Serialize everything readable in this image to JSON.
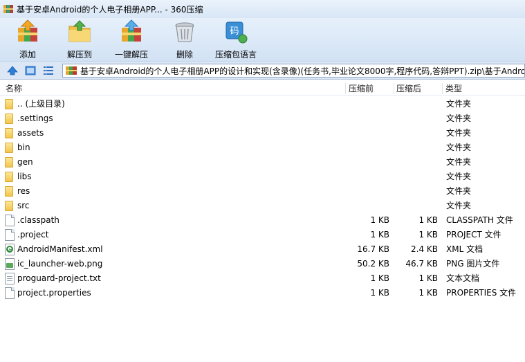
{
  "window": {
    "title": "基于安卓Android的个人电子相册APP... - 360压缩"
  },
  "toolbar": {
    "add_label": "添加",
    "extract_to_label": "解压到",
    "one_click_extract_label": "一键解压",
    "delete_label": "删除",
    "language_pack_label": "压缩包语言"
  },
  "address": {
    "path": "基于安卓Android的个人电子相册APP的设计和实现(含录像)(任务书,毕业论文8000字,程序代码,答辩PPT).zip\\基于Android"
  },
  "columns": {
    "name": "名称",
    "size": "压缩前",
    "compressed": "压缩后",
    "type": "类型"
  },
  "files": [
    {
      "name": ".. (上级目录)",
      "size": "",
      "compressed": "",
      "type": "文件夹",
      "icon": "folder-icon"
    },
    {
      "name": ".settings",
      "size": "",
      "compressed": "",
      "type": "文件夹",
      "icon": "folder-icon"
    },
    {
      "name": "assets",
      "size": "",
      "compressed": "",
      "type": "文件夹",
      "icon": "folder-icon"
    },
    {
      "name": "bin",
      "size": "",
      "compressed": "",
      "type": "文件夹",
      "icon": "folder-icon"
    },
    {
      "name": "gen",
      "size": "",
      "compressed": "",
      "type": "文件夹",
      "icon": "folder-icon"
    },
    {
      "name": "libs",
      "size": "",
      "compressed": "",
      "type": "文件夹",
      "icon": "folder-icon"
    },
    {
      "name": "res",
      "size": "",
      "compressed": "",
      "type": "文件夹",
      "icon": "folder-icon"
    },
    {
      "name": "src",
      "size": "",
      "compressed": "",
      "type": "文件夹",
      "icon": "folder-icon"
    },
    {
      "name": ".classpath",
      "size": "1 KB",
      "compressed": "1 KB",
      "type": "CLASSPATH 文件",
      "icon": "file-icon"
    },
    {
      "name": ".project",
      "size": "1 KB",
      "compressed": "1 KB",
      "type": "PROJECT 文件",
      "icon": "file-icon"
    },
    {
      "name": "AndroidManifest.xml",
      "size": "16.7 KB",
      "compressed": "2.4 KB",
      "type": "XML 文档",
      "icon": "xml-file-icon"
    },
    {
      "name": "ic_launcher-web.png",
      "size": "50.2 KB",
      "compressed": "46.7 KB",
      "type": "PNG 图片文件",
      "icon": "png-file-icon"
    },
    {
      "name": "proguard-project.txt",
      "size": "1 KB",
      "compressed": "1 KB",
      "type": "文本文档",
      "icon": "text-file-icon"
    },
    {
      "name": "project.properties",
      "size": "1 KB",
      "compressed": "1 KB",
      "type": "PROPERTIES 文件",
      "icon": "file-icon"
    }
  ]
}
